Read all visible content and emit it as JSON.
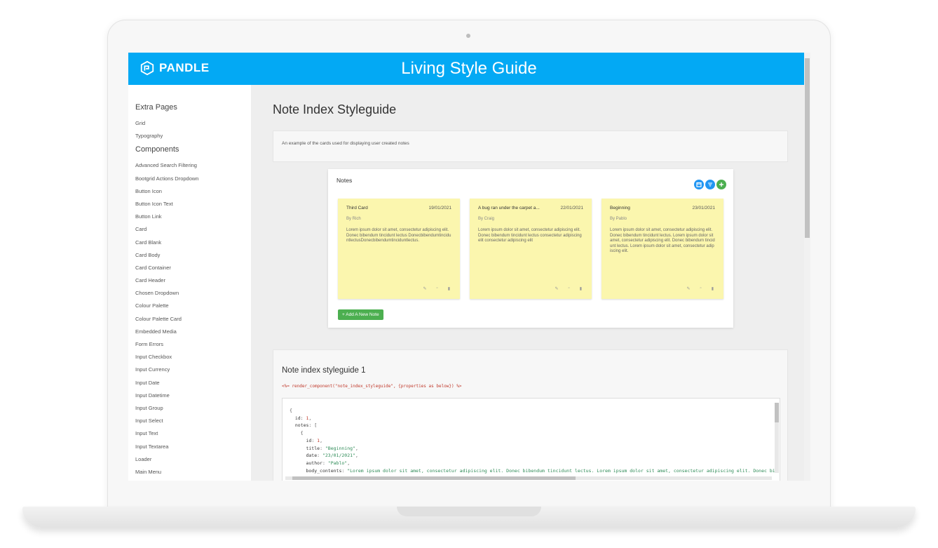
{
  "header": {
    "brand": "PANDLE",
    "title": "Living Style Guide"
  },
  "sidebar": {
    "sections": [
      {
        "heading": "Extra Pages",
        "items": [
          "Grid",
          "Typography"
        ]
      },
      {
        "heading": "Components",
        "items": [
          "Advanced Search Filtering",
          "Bootgrid Actions Dropdown",
          "Button Icon",
          "Button Icon Text",
          "Button Link",
          "Card",
          "Card Blank",
          "Card Body",
          "Card Container",
          "Card Header",
          "Chosen Dropdown",
          "Colour Palette",
          "Colour Palette Card",
          "Embedded Media",
          "Form Errors",
          "Input Checkbox",
          "Input Currency",
          "Input Date",
          "Input Datetime",
          "Input Group",
          "Input Select",
          "Input Text",
          "Input Textarea",
          "Loader",
          "Main Menu"
        ]
      }
    ]
  },
  "main": {
    "page_title": "Note Index Styleguide",
    "description": "An example of the cards used for displaying user created notes",
    "notes_card": {
      "title": "Notes",
      "notes": [
        {
          "title": "Third Card",
          "date": "19/01/2021",
          "author": "By Rich",
          "body": "Lorem ipsum dolor sit amet, consectetur adipiscing elit. Donec bibendum tincidunt lectus DonecbibendumtinciduntlectusDonecbibendumtinciduntlectus."
        },
        {
          "title": "A bug ran under the carpet a...",
          "date": "22/01/2021",
          "author": "By Craig",
          "body": "Lorem ipsum dolor sit amet, consectetur adipiscing elit. Donec bibendum tincidunt lectus consectetur adipiscing elit consectetur adipiscing elit"
        },
        {
          "title": "Beginning",
          "date": "23/01/2021",
          "author": "By Pablo",
          "body": "Lorem ipsum dolor sit amet, consectetur adipiscing elit. Donec bibendum tincidunt lectus. Lorem ipsum dolor sit amet, consectetur adipiscing elit. Donec bibendum tincidunt lectus. Lorem ipsum dolor sit amet, consectetur adipiscing elit."
        }
      ],
      "add_button": "+ Add A New Note"
    },
    "code_panel": {
      "heading": "Note index styleguide 1",
      "render_line": "<%= render_component(\"note_index_styleguide\", {properties as below}) %>",
      "code": {
        "open_brace": "{",
        "id_key": "id",
        "id_value": "1",
        "notes_key": "notes",
        "notes_open": "[",
        "item_open": "{",
        "item_id_key": "id",
        "item_id_value": "1",
        "title_key": "title",
        "title_value": "\"Beginning\"",
        "date_key": "date",
        "date_value": "\"23/01/2021\"",
        "author_key": "author",
        "author_value": "\"Pablo\"",
        "body_key": "body_contents",
        "body_value": "\"Lorem ipsum dolor sit amet, consectetur adipiscing elit. Donec bibendum tincidunt lectus. Lorem ipsum dolor sit amet, consectetur adipiscing elit. Donec bi"
      }
    }
  },
  "icons": {
    "note_actions": [
      "pencil-icon",
      "copy-icon",
      "trash-icon"
    ],
    "round_buttons": [
      "calendar-icon",
      "filter-icon",
      "plus-icon"
    ]
  },
  "colors": {
    "topbar": "#03a9f4",
    "note_bg": "#fbf6ae",
    "add_button": "#4caf50",
    "round_blue": "#2196f3",
    "round_green": "#4caf50"
  }
}
